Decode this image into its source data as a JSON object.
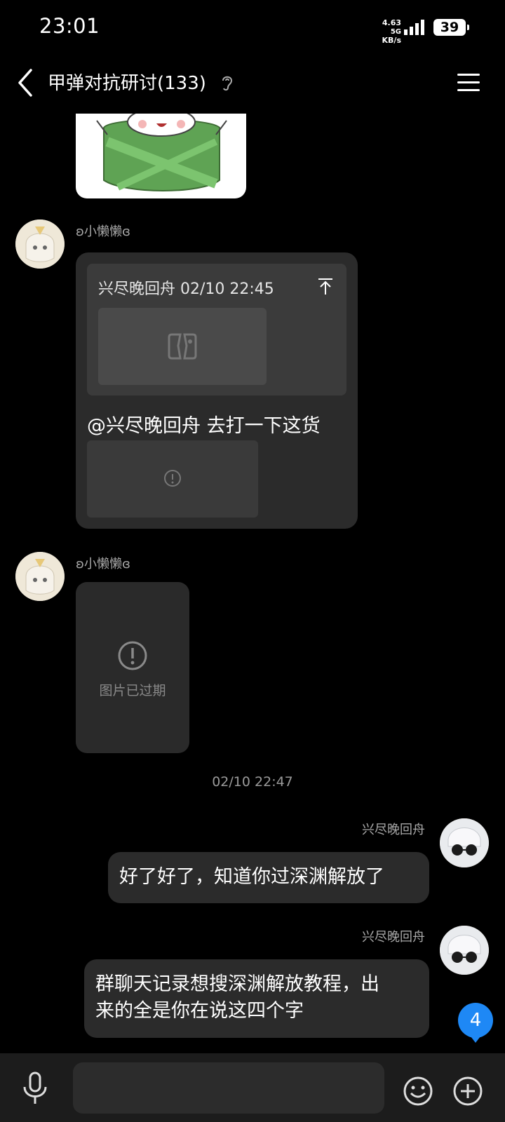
{
  "status_bar": {
    "time": "23:01",
    "net_speed": "4.63",
    "net_unit": "KB/s",
    "network_type": "5G",
    "battery": "39"
  },
  "header": {
    "title": "甲弹对抗研讨(133)"
  },
  "messages": [
    {
      "sender": "ʚ小懒懒ɞ",
      "quote_header": "兴尽晚回舟 02/10 22:45",
      "text": "@兴尽晚回舟 去打一下这货"
    },
    {
      "sender": "ʚ小懒懒ɞ",
      "image_status": "图片已过期"
    }
  ],
  "timestamp": "02/10 22:47",
  "my_messages": [
    {
      "sender": "兴尽晚回舟",
      "text": "好了好了，知道你过深渊解放了"
    },
    {
      "sender": "兴尽晚回舟",
      "text_line1": "群聊天记录想搜深渊解放教程，出",
      "text_line2": "来的全是你在说这四个字"
    }
  ],
  "unread_count": "4",
  "colors": {
    "background": "#000000",
    "bubble": "#2b2b2b",
    "badge": "#1e88f5"
  }
}
